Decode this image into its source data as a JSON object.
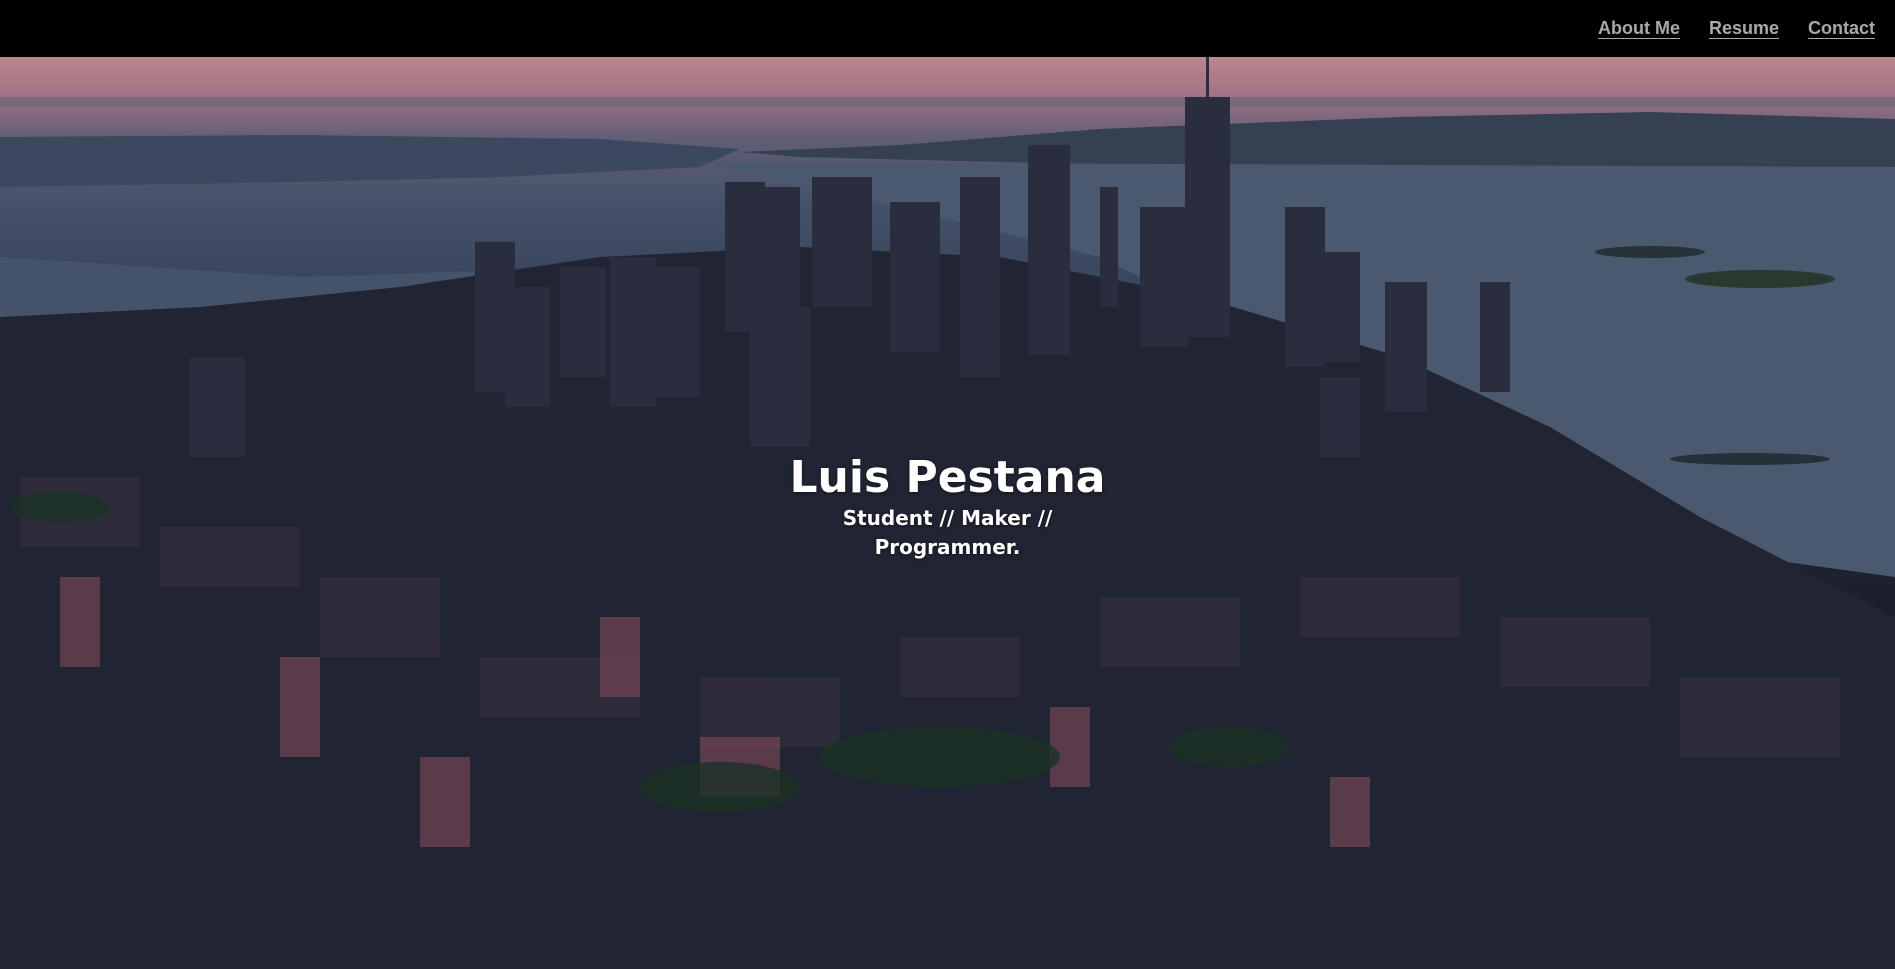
{
  "nav": {
    "links": [
      {
        "label": "About Me"
      },
      {
        "label": "Resume"
      },
      {
        "label": "Contact"
      }
    ],
    "link_color": "#a9a9a9",
    "background": "#000000"
  },
  "hero": {
    "title": "Luis Pestana",
    "tagline": "Student // Maker // Programmer.",
    "background_description_colors": {
      "sky_top": "#d49aa3",
      "water": "#4f5d78",
      "city": "#1f2433"
    }
  }
}
